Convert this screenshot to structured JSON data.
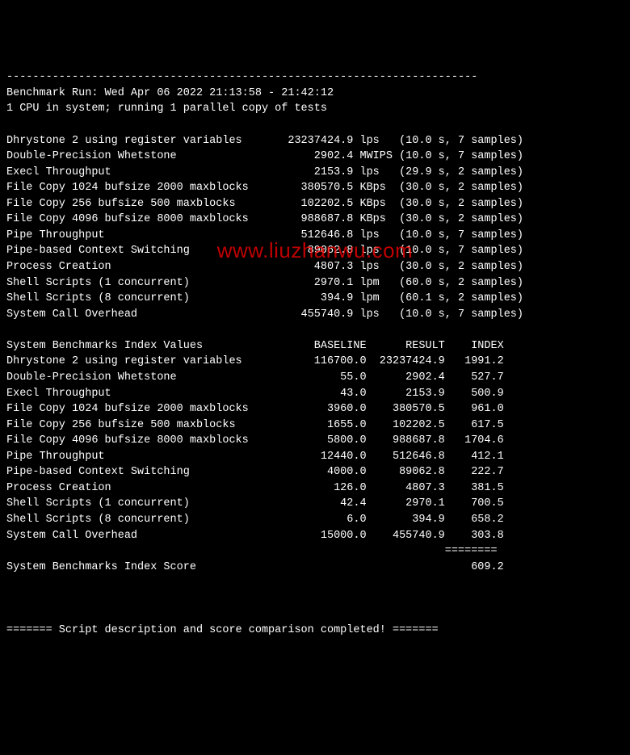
{
  "divider_top": "------------------------------------------------------------------------",
  "header": {
    "line1": "Benchmark Run: Wed Apr 06 2022 21:13:58 - 21:42:12",
    "line2": "1 CPU in system; running 1 parallel copy of tests"
  },
  "results": [
    {
      "name": "Dhrystone 2 using register variables",
      "value": "23237424.9",
      "unit": "lps",
      "time": "10.0",
      "samples": "7"
    },
    {
      "name": "Double-Precision Whetstone",
      "value": "2902.4",
      "unit": "MWIPS",
      "time": "10.0",
      "samples": "7"
    },
    {
      "name": "Execl Throughput",
      "value": "2153.9",
      "unit": "lps",
      "time": "29.9",
      "samples": "2"
    },
    {
      "name": "File Copy 1024 bufsize 2000 maxblocks",
      "value": "380570.5",
      "unit": "KBps",
      "time": "30.0",
      "samples": "2"
    },
    {
      "name": "File Copy 256 bufsize 500 maxblocks",
      "value": "102202.5",
      "unit": "KBps",
      "time": "30.0",
      "samples": "2"
    },
    {
      "name": "File Copy 4096 bufsize 8000 maxblocks",
      "value": "988687.8",
      "unit": "KBps",
      "time": "30.0",
      "samples": "2"
    },
    {
      "name": "Pipe Throughput",
      "value": "512646.8",
      "unit": "lps",
      "time": "10.0",
      "samples": "7"
    },
    {
      "name": "Pipe-based Context Switching",
      "value": "89062.8",
      "unit": "lps",
      "time": "10.0",
      "samples": "7"
    },
    {
      "name": "Process Creation",
      "value": "4807.3",
      "unit": "lps",
      "time": "30.0",
      "samples": "2"
    },
    {
      "name": "Shell Scripts (1 concurrent)",
      "value": "2970.1",
      "unit": "lpm",
      "time": "60.0",
      "samples": "2"
    },
    {
      "name": "Shell Scripts (8 concurrent)",
      "value": "394.9",
      "unit": "lpm",
      "time": "60.1",
      "samples": "2"
    },
    {
      "name": "System Call Overhead",
      "value": "455740.9",
      "unit": "lps",
      "time": "10.0",
      "samples": "7"
    }
  ],
  "index_header": {
    "title": "System Benchmarks Index Values",
    "col1": "BASELINE",
    "col2": "RESULT",
    "col3": "INDEX"
  },
  "index_rows": [
    {
      "name": "Dhrystone 2 using register variables",
      "baseline": "116700.0",
      "result": "23237424.9",
      "index": "1991.2"
    },
    {
      "name": "Double-Precision Whetstone",
      "baseline": "55.0",
      "result": "2902.4",
      "index": "527.7"
    },
    {
      "name": "Execl Throughput",
      "baseline": "43.0",
      "result": "2153.9",
      "index": "500.9"
    },
    {
      "name": "File Copy 1024 bufsize 2000 maxblocks",
      "baseline": "3960.0",
      "result": "380570.5",
      "index": "961.0"
    },
    {
      "name": "File Copy 256 bufsize 500 maxblocks",
      "baseline": "1655.0",
      "result": "102202.5",
      "index": "617.5"
    },
    {
      "name": "File Copy 4096 bufsize 8000 maxblocks",
      "baseline": "5800.0",
      "result": "988687.8",
      "index": "1704.6"
    },
    {
      "name": "Pipe Throughput",
      "baseline": "12440.0",
      "result": "512646.8",
      "index": "412.1"
    },
    {
      "name": "Pipe-based Context Switching",
      "baseline": "4000.0",
      "result": "89062.8",
      "index": "222.7"
    },
    {
      "name": "Process Creation",
      "baseline": "126.0",
      "result": "4807.3",
      "index": "381.5"
    },
    {
      "name": "Shell Scripts (1 concurrent)",
      "baseline": "42.4",
      "result": "2970.1",
      "index": "700.5"
    },
    {
      "name": "Shell Scripts (8 concurrent)",
      "baseline": "6.0",
      "result": "394.9",
      "index": "658.2"
    },
    {
      "name": "System Call Overhead",
      "baseline": "15000.0",
      "result": "455740.9",
      "index": "303.8"
    }
  ],
  "score_divider": "                                                                   ========",
  "score": {
    "label": "System Benchmarks Index Score",
    "value": "609.2"
  },
  "footer": "======= Script description and score comparison completed! =======",
  "watermark": "www.liuzhanwu.com"
}
